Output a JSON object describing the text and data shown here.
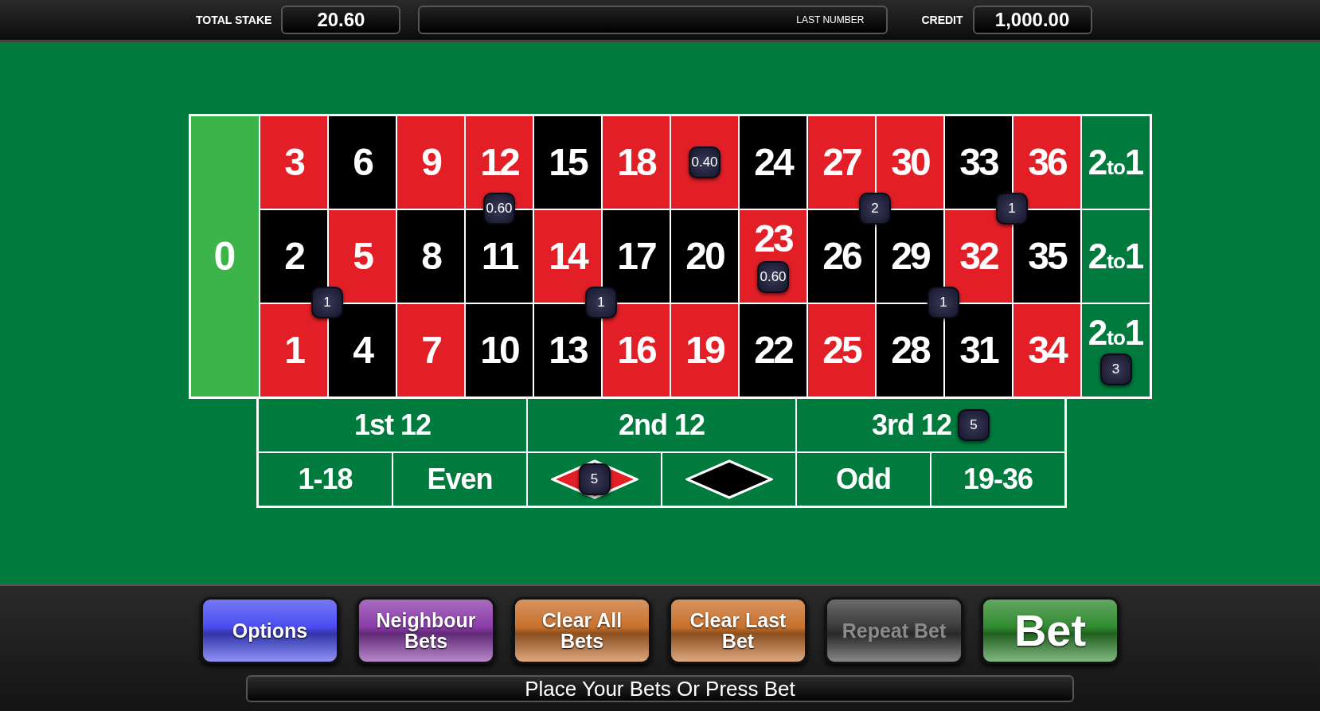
{
  "header": {
    "total_stake_label": "TOTAL STAKE",
    "total_stake": "20.60",
    "last_number_label": "LAST NUMBER",
    "credit_label": "CREDIT",
    "credit": "1,000.00"
  },
  "table": {
    "zero": {
      "label": "0"
    },
    "rows": [
      [
        {
          "label": "3",
          "color": "#e21f26"
        },
        {
          "label": "6",
          "color": "#000000"
        },
        {
          "label": "9",
          "color": "#e21f26"
        },
        {
          "label": "12",
          "color": "#e21f26"
        },
        {
          "label": "15",
          "color": "#000000"
        },
        {
          "label": "18",
          "color": "#e21f26"
        },
        {
          "color": "#e21f26",
          "chip": {
            "amount": "0.40",
            "kind": "center"
          }
        },
        {
          "label": "24",
          "color": "#000000"
        },
        {
          "label": "27",
          "color": "#e21f26"
        },
        {
          "label": "30",
          "color": "#e21f26"
        },
        {
          "label": "33",
          "color": "#000000"
        },
        {
          "label": "36",
          "color": "#e21f26"
        }
      ],
      [
        {
          "label": "2",
          "color": "#000000"
        },
        {
          "label": "5",
          "color": "#e21f26"
        },
        {
          "label": "8",
          "color": "#000000"
        },
        {
          "label": "11",
          "color": "#000000",
          "chip": {
            "amount": "0.60",
            "kind": "edge"
          }
        },
        {
          "label": "14",
          "color": "#e21f26"
        },
        {
          "label": "17",
          "color": "#000000"
        },
        {
          "label": "20",
          "color": "#000000"
        },
        {
          "label": "23",
          "color": "#e21f26",
          "chip": {
            "amount": "0.60",
            "kind": "center"
          }
        },
        {
          "label": "26",
          "color": "#000000"
        },
        {
          "label": "29",
          "color": "#000000",
          "chip": {
            "amount": "2",
            "kind": "corner"
          }
        },
        {
          "label": "32",
          "color": "#e21f26"
        },
        {
          "label": "35",
          "color": "#000000",
          "chip": {
            "amount": "1",
            "kind": "corner"
          }
        }
      ],
      [
        {
          "label": "1",
          "color": "#e21f26"
        },
        {
          "label": "4",
          "color": "#000000",
          "chip": {
            "amount": "1",
            "kind": "corner"
          }
        },
        {
          "label": "7",
          "color": "#e21f26"
        },
        {
          "label": "10",
          "color": "#000000"
        },
        {
          "label": "13",
          "color": "#000000"
        },
        {
          "label": "16",
          "color": "#e21f26",
          "chip": {
            "amount": "1",
            "kind": "corner"
          }
        },
        {
          "label": "19",
          "color": "#e21f26"
        },
        {
          "label": "22",
          "color": "#000000"
        },
        {
          "label": "25",
          "color": "#e21f26"
        },
        {
          "label": "28",
          "color": "#000000"
        },
        {
          "label": "31",
          "color": "#000000",
          "chip": {
            "amount": "1",
            "kind": "corner"
          }
        },
        {
          "label": "34",
          "color": "#e21f26"
        }
      ]
    ],
    "column_bets": [
      {
        "label": "2$_{to}$1"
      },
      {
        "label": "2$_{to}$1"
      },
      {
        "label": "2$_{to}$1",
        "chip": {
          "amount": "3"
        }
      }
    ],
    "dozens": [
      {
        "label": "1st 12"
      },
      {
        "label": "2nd 12"
      },
      {
        "label": "3rd 12",
        "chip": {
          "amount": "5"
        }
      }
    ],
    "outside": [
      {
        "kind": "text",
        "label": "1-18"
      },
      {
        "kind": "text",
        "label": "Even"
      },
      {
        "kind": "diamond",
        "color": "#e21f26",
        "chip": {
          "amount": "5"
        }
      },
      {
        "kind": "diamond",
        "color": "#000000"
      },
      {
        "kind": "text",
        "label": "Odd"
      },
      {
        "kind": "text",
        "label": "19-36"
      }
    ]
  },
  "buttons": [
    {
      "label": "Options",
      "color": "#4a4af0",
      "kind": "normal",
      "disabled": false
    },
    {
      "label": "Neighbour\nBets",
      "color": "#8a3aa8",
      "kind": "normal",
      "disabled": false
    },
    {
      "label": "Clear All\nBets",
      "color": "#c8702a",
      "kind": "normal",
      "disabled": false
    },
    {
      "label": "Clear Last\nBet",
      "color": "#c8702a",
      "kind": "normal",
      "disabled": false
    },
    {
      "label": "Repeat Bet",
      "color": "#3a3a3a",
      "kind": "normal",
      "disabled": true
    },
    {
      "label": "Bet",
      "color": "#2e8a2e",
      "kind": "primary",
      "disabled": false
    }
  ],
  "status": "Place Your Bets Or Press Bet"
}
